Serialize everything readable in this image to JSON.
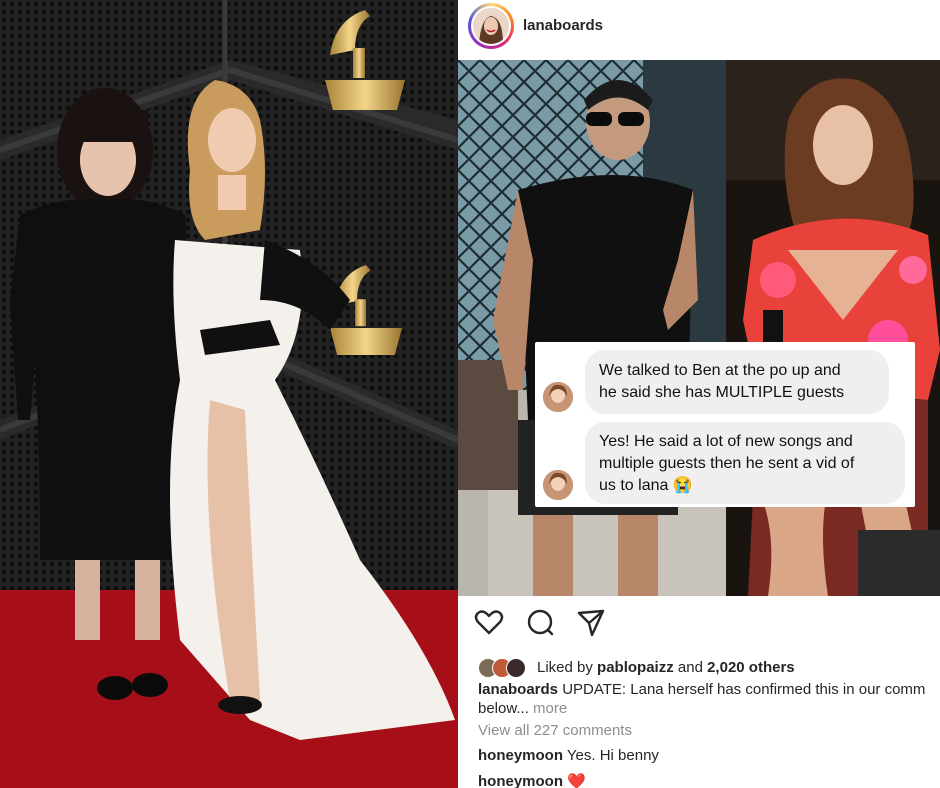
{
  "post": {
    "username": "lanaboards",
    "dm_messages": [
      {
        "text_line1": "We talked to Ben at the po up and",
        "text_line2": "he said she has MULTIPLE guests"
      },
      {
        "text_line1": "Yes! He said a lot of new songs and",
        "text_line2": "multiple guests then he sent a vid of",
        "text_line3": "us to lana 😭"
      }
    ],
    "actions": [
      "heart-icon",
      "comment-icon",
      "share-icon"
    ],
    "likes": {
      "prefix": "Liked by",
      "user": "pablopaizz",
      "connector": "and",
      "count": "2,020 others"
    },
    "caption": {
      "username": "lanaboards",
      "text_line1": "UPDATE: Lana herself has confirmed this in our comm",
      "text_line2": "below...",
      "more": "more"
    },
    "view_all_comments": "View all 227 comments",
    "comments": [
      {
        "username": "honeymoon",
        "text": "Yes. Hi benny"
      },
      {
        "username": "honeymoon",
        "text": "❤️"
      }
    ]
  },
  "colors": {
    "text": "#262626",
    "muted": "#8e8e8e",
    "bubble": "#efefef",
    "carpet": "#b3111a"
  }
}
